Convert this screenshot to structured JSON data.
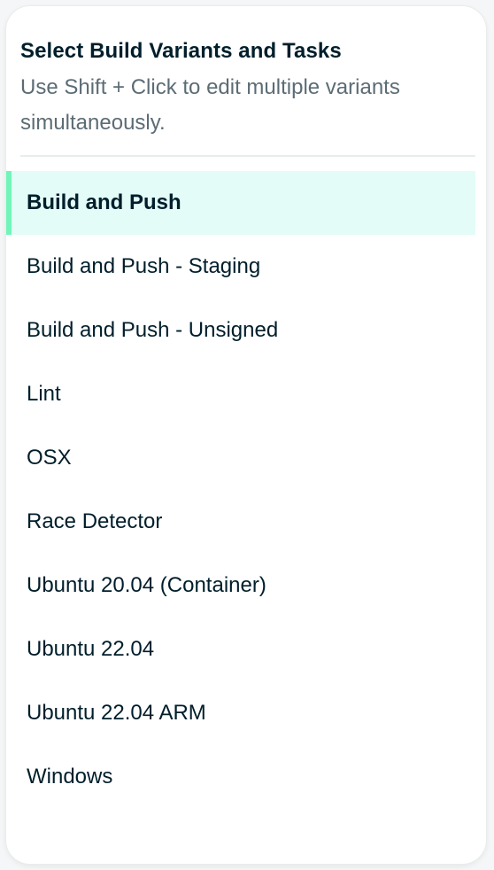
{
  "header": {
    "title": "Select Build Variants and Tasks",
    "subtitle": "Use Shift + Click to edit multiple variants simultaneously."
  },
  "variants": [
    {
      "label": "Build and Push",
      "selected": true
    },
    {
      "label": "Build and Push - Staging",
      "selected": false
    },
    {
      "label": "Build and Push - Unsigned",
      "selected": false
    },
    {
      "label": "Lint",
      "selected": false
    },
    {
      "label": "OSX",
      "selected": false
    },
    {
      "label": "Race Detector",
      "selected": false
    },
    {
      "label": "Ubuntu 20.04 (Container)",
      "selected": false
    },
    {
      "label": "Ubuntu 22.04",
      "selected": false
    },
    {
      "label": "Ubuntu 22.04 ARM",
      "selected": false
    },
    {
      "label": "Windows",
      "selected": false
    }
  ],
  "colors": {
    "selected_background": "#e3fcf7",
    "selected_accent": "#71f6ba",
    "title_text": "#001e2b",
    "subtitle_text": "#5c6c75"
  }
}
